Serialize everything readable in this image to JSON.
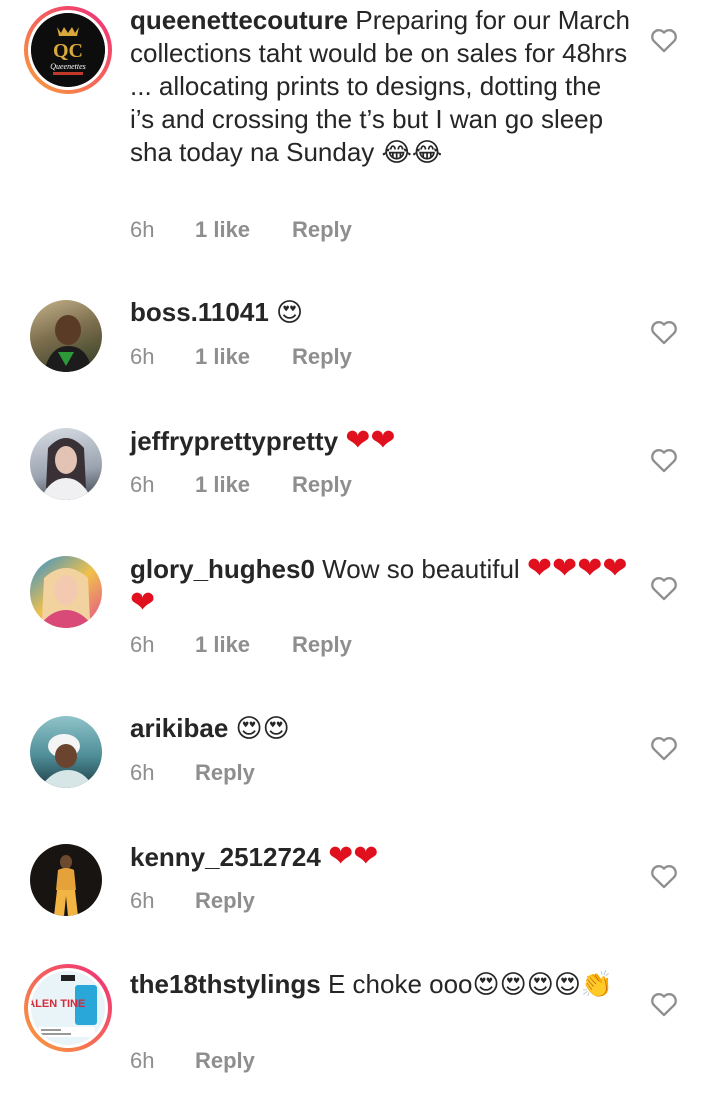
{
  "comments": [
    {
      "username": "queenettecouture",
      "text": "Preparing for our March collections taht would be on sales for 48hrs ... allocating prints to designs, dotting the i’s and crossing the t’s but I wan go sleep sha today na Sunday ",
      "emoji": "😂😂",
      "time": "6h",
      "likes": "1 like",
      "reply": "Reply",
      "avatar_brand": "QC",
      "avatar_brand_sub": "Queenettes"
    },
    {
      "username": "boss.11041",
      "text": "",
      "emoji": "😍",
      "time": "6h",
      "likes": "1 like",
      "reply": "Reply"
    },
    {
      "username": "jeffryprettypretty",
      "text": "",
      "emoji": "❤❤",
      "time": "6h",
      "likes": "1 like",
      "reply": "Reply"
    },
    {
      "username": "glory_hughes0",
      "text": "Wow so beautiful ",
      "emoji": "❤❤❤❤❤",
      "time": "6h",
      "likes": "1 like",
      "reply": "Reply"
    },
    {
      "username": "arikibae",
      "text": "",
      "emoji": "😍😍",
      "time": "6h",
      "likes": "",
      "reply": "Reply"
    },
    {
      "username": "kenny_2512724",
      "text": "",
      "emoji": "❤❤",
      "time": "6h",
      "likes": "",
      "reply": "Reply"
    },
    {
      "username": "the18thstylings",
      "text": "E choke ooo",
      "emoji": "😍😍😍😍👏",
      "time": "6h",
      "likes": "",
      "reply": "Reply",
      "avatar_brand": "VALEN TINE"
    }
  ],
  "colors": {
    "muted": "#8e8e8e",
    "text": "#262626",
    "heart_red": "#e0101e"
  },
  "icons": {
    "like": "heart-outline-icon"
  }
}
